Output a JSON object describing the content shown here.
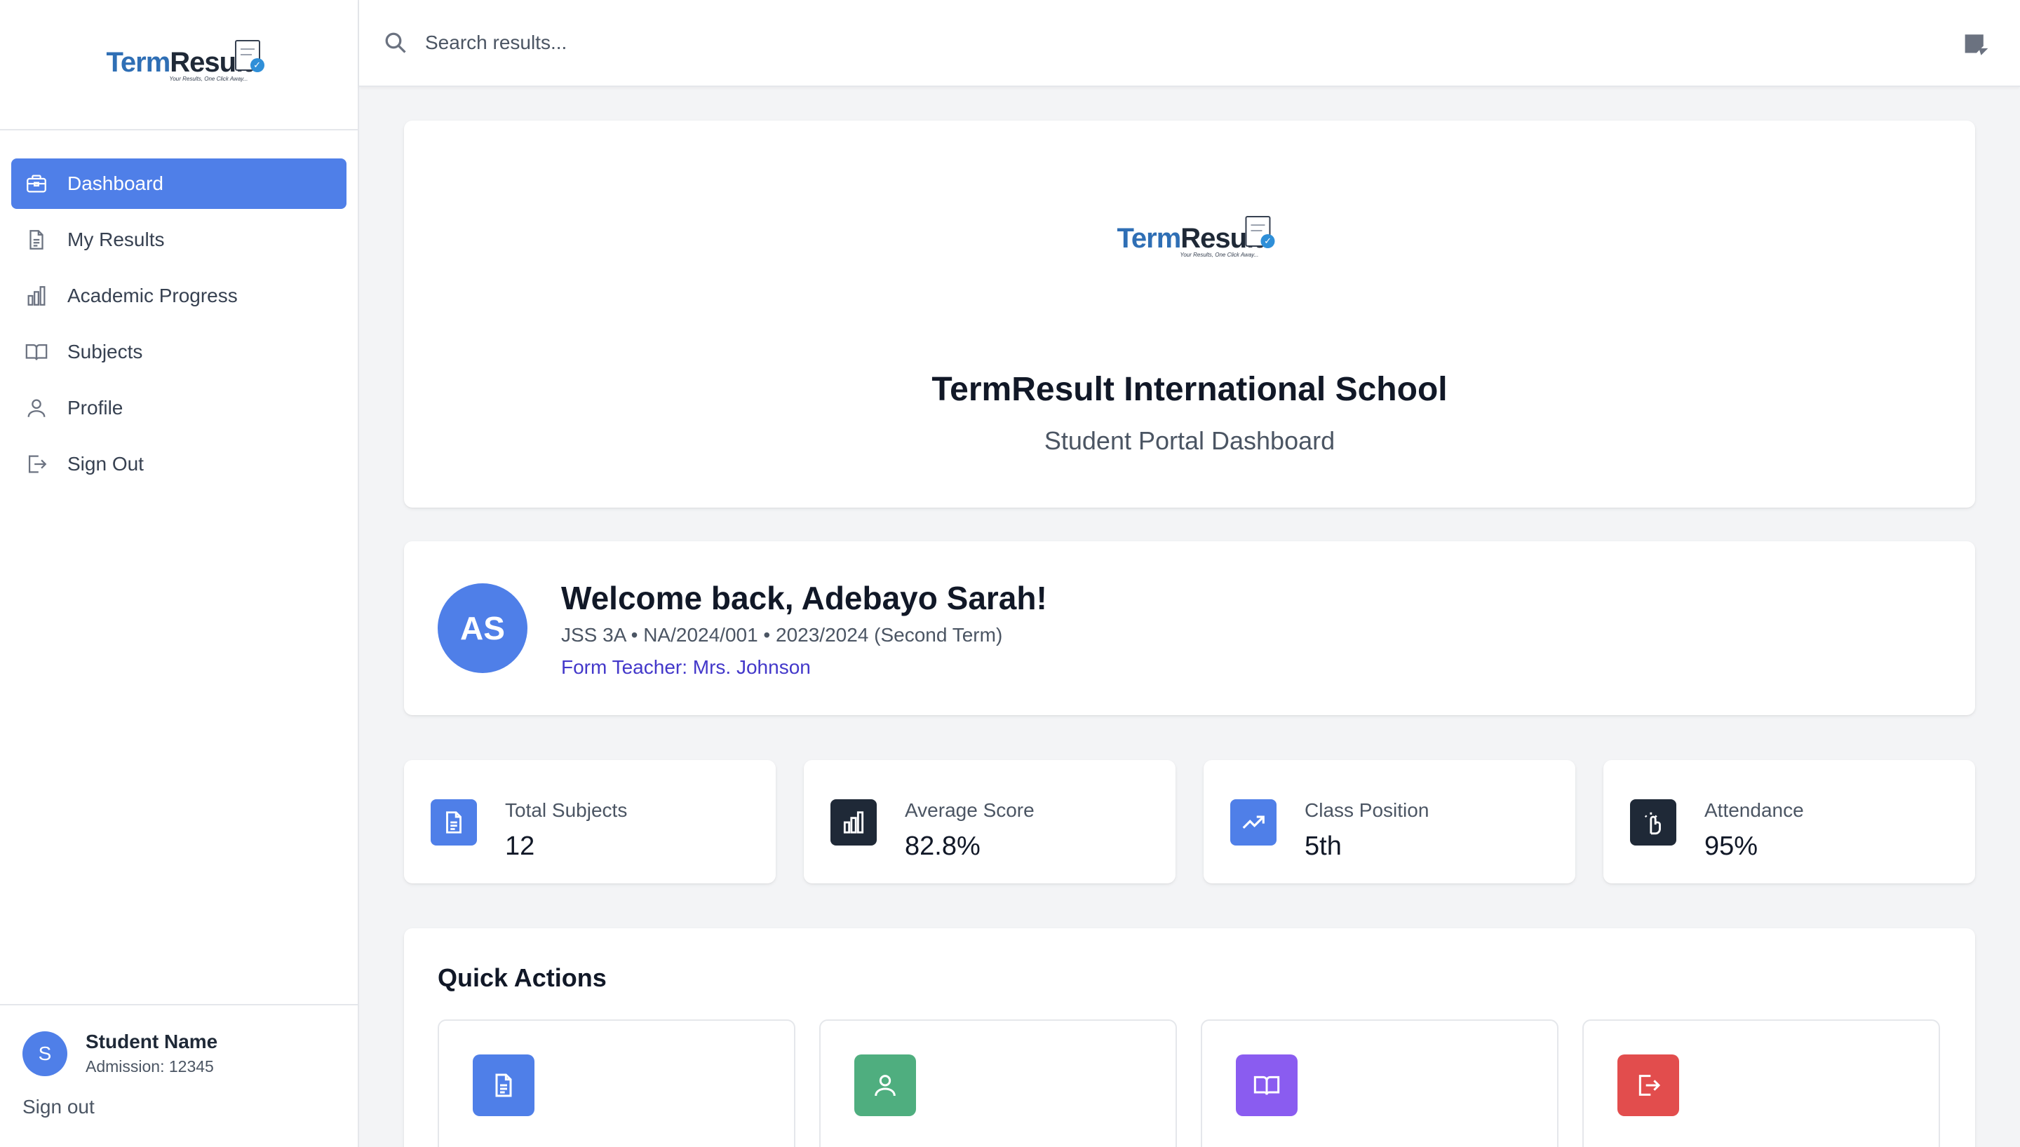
{
  "brand": {
    "logo_part1": "Term",
    "logo_part2": "Result",
    "logo_tagline": "Your Results, One Click Away..."
  },
  "sidebar": {
    "items": [
      {
        "label": "Dashboard",
        "icon": "briefcase-icon",
        "active": true
      },
      {
        "label": "My Results",
        "icon": "document-icon"
      },
      {
        "label": "Academic Progress",
        "icon": "bar-chart-icon"
      },
      {
        "label": "Subjects",
        "icon": "open-book-icon"
      },
      {
        "label": "Profile",
        "icon": "user-icon"
      },
      {
        "label": "Sign Out",
        "icon": "sign-out-icon"
      }
    ],
    "footer": {
      "avatar_initial": "S",
      "name": "Student Name",
      "admission": "Admission: 12345",
      "signout": "Sign out"
    }
  },
  "topbar": {
    "search_placeholder": "Search results...",
    "search_value": ""
  },
  "school": {
    "name": "TermResult International School",
    "subtitle": "Student Portal Dashboard"
  },
  "welcome": {
    "initials": "AS",
    "title": "Welcome back, Adebayo Sarah!",
    "meta": "JSS 3A • NA/2024/001 • 2023/2024 (Second Term)",
    "teacher": "Form Teacher: Mrs. Johnson"
  },
  "stats": [
    {
      "label": "Total Subjects",
      "value": "12",
      "icon": "document-icon",
      "color": "#4f7fe8"
    },
    {
      "label": "Average Score",
      "value": "82.8%",
      "icon": "bar-chart-icon",
      "color": "#1f2937"
    },
    {
      "label": "Class Position",
      "value": "5th",
      "icon": "trending-up-icon",
      "color": "#4f7fe8"
    },
    {
      "label": "Attendance",
      "value": "95%",
      "icon": "hand-pointer-icon",
      "color": "#1f2937"
    }
  ],
  "quick_actions": {
    "title": "Quick Actions",
    "tiles": [
      {
        "icon": "document-icon",
        "color": "#4f7fe8"
      },
      {
        "icon": "user-icon",
        "color": "#4fae7f"
      },
      {
        "icon": "open-book-icon",
        "color": "#8a5cf0"
      },
      {
        "icon": "sign-out-icon",
        "color": "#e24d4d"
      }
    ]
  },
  "colors": {
    "accent": "#4f7fe8",
    "teacher_link": "#4338ca",
    "background": "#f3f4f6"
  }
}
